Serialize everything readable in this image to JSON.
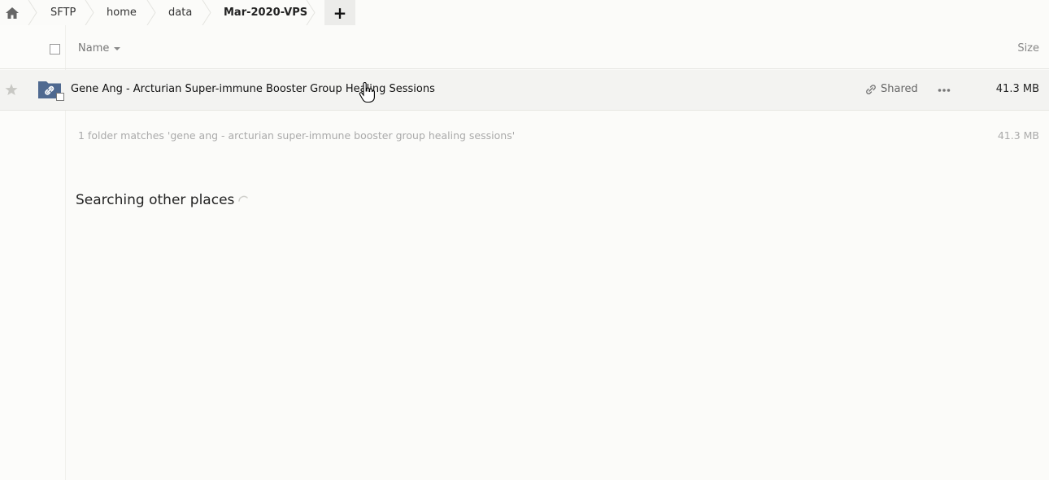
{
  "breadcrumb": {
    "home_icon": "home-icon",
    "items": [
      "SFTP",
      "home",
      "data",
      "Mar-2020-VPS"
    ],
    "add_icon": "plus-icon",
    "add_label": "+"
  },
  "header": {
    "name_label": "Name",
    "size_label": "Size"
  },
  "files": [
    {
      "name": "Gene Ang - Arcturian Super-immune Booster Group Healing Sessions",
      "icon": "shared-folder-icon",
      "shared_label": "Shared",
      "size": "41.3 MB"
    }
  ],
  "summary": {
    "text": "1 folder matches 'gene ang - arcturian super-immune booster group healing sessions'",
    "size": "41.3 MB"
  },
  "search_other": {
    "label": "Searching other places"
  },
  "colors": {
    "background": "#fbfbf9",
    "row_hover": "#f3f3f1",
    "folder": "#4f6990"
  }
}
